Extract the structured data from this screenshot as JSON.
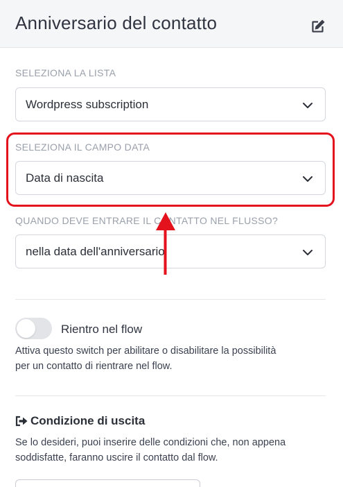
{
  "header": {
    "title": "Anniversario del contatto"
  },
  "fields": {
    "list": {
      "label": "SELEZIONA LA LISTA",
      "value": "Wordpress subscription"
    },
    "date_field": {
      "label": "SELEZIONA IL CAMPO DATA",
      "value": "Data di nascita"
    },
    "when": {
      "label": "QUANDO DEVE ENTRARE IL CONTATTO NEL FLUSSO?",
      "value": "nella data dell'anniversario"
    }
  },
  "reentry": {
    "label": "Rientro nel flow",
    "enabled": false,
    "help_line1": "Attiva questo switch per abilitare o disabilitare la possibilità",
    "help_line2": "per un contatto di rientrare nel flow."
  },
  "exit": {
    "title": "Condizione di uscita",
    "help_line1": "Se lo desideri, puoi inserire delle condizioni che, non appena",
    "help_line2": "soddisfatte, faranno uscire il contatto dal flow."
  },
  "colors": {
    "highlight": "#e3121c",
    "header_bg": "#f5f6f8",
    "label": "#9aa0ab"
  },
  "icons": {
    "edit": "edit-icon",
    "chevron": "chevron-down-icon",
    "exit": "sign-out-icon"
  }
}
